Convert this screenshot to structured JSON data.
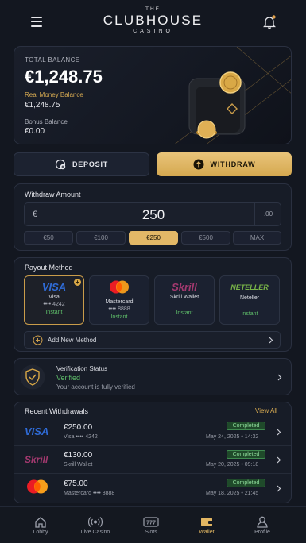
{
  "header": {
    "logo_top": "THE",
    "logo_main": "CLUBHOUSE",
    "logo_sub": "CASINO"
  },
  "balance": {
    "total_label": "TOTAL BALANCE",
    "total_value": "€1,248.75",
    "real_label": "Real Money Balance",
    "real_value": "€1,248.75",
    "bonus_label": "Bonus Balance",
    "bonus_value": "€0.00"
  },
  "actions": {
    "deposit_label": "DEPOSIT",
    "withdraw_label": "WITHDRAW"
  },
  "withdraw": {
    "title": "Withdraw Amount",
    "currency": "€",
    "amount": "250",
    "decimals": ".00",
    "chips": [
      "€50",
      "€100",
      "€250",
      "€500",
      "MAX"
    ],
    "selected_chip": "€250"
  },
  "payout": {
    "title": "Payout Method",
    "methods": [
      {
        "logo": "VISA",
        "name": "Visa",
        "digits": "•••• 4242",
        "status": "Instant"
      },
      {
        "logo": "",
        "name": "Mastercard",
        "digits": "•••• 8888",
        "status": "Instant"
      },
      {
        "logo": "Skrill",
        "name": "Skrill Wallet",
        "digits": "",
        "status": "Instant"
      },
      {
        "logo": "NETELLER",
        "name": "Neteller",
        "digits": "",
        "status": "Instant"
      }
    ],
    "add_label": "Add New Method"
  },
  "verification": {
    "title": "Verification Status",
    "status": "Verified",
    "subtitle": "Your account is fully verified"
  },
  "recent": {
    "title": "Recent Withdrawals",
    "view_all": "View All",
    "rows": [
      {
        "logo": "VISA",
        "amount": "€250.00",
        "method": "Visa",
        "digits": "•••• 4242",
        "status": "Completed",
        "date": "May 24, 2025 • 14:32"
      },
      {
        "logo": "Skrill",
        "amount": "€130.00",
        "method": "Skrill Wallet",
        "digits": "",
        "status": "Completed",
        "date": "May 20, 2025 • 09:18"
      },
      {
        "logo": "",
        "amount": "€75.00",
        "method": "Mastercard",
        "digits": "•••• 8888",
        "status": "Completed",
        "date": "May 18, 2025 • 21:45"
      }
    ]
  },
  "nav": {
    "items": [
      "Lobby",
      "Live Casino",
      "Slots",
      "Wallet",
      "Profile"
    ],
    "active": "Wallet"
  },
  "colors": {
    "accent": "#e3b867",
    "success": "#5fbf6a",
    "background": "#131720"
  }
}
